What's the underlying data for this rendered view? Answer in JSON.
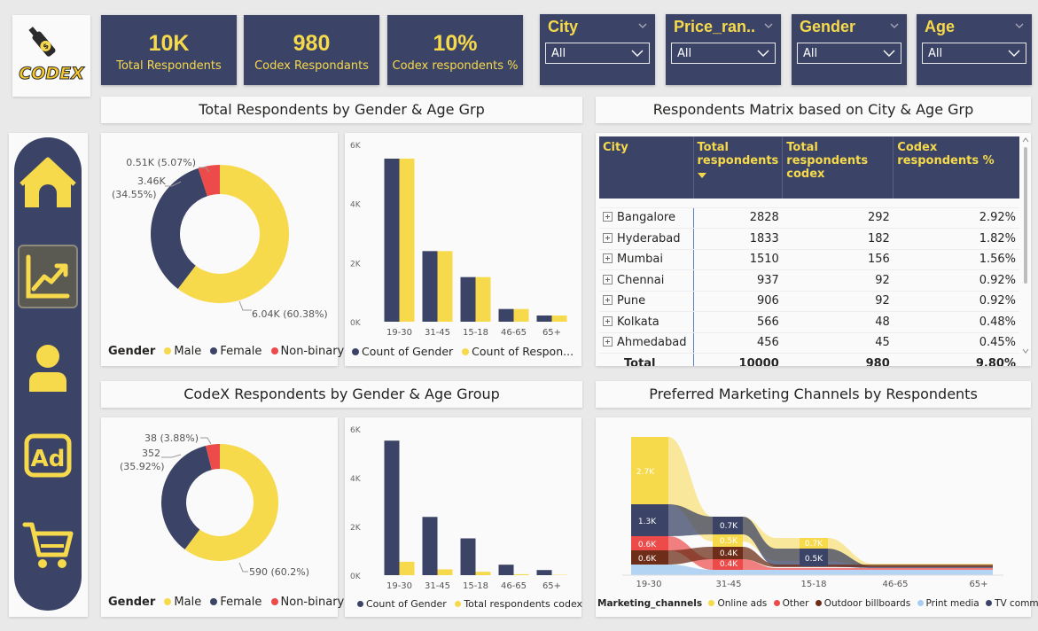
{
  "logo": {
    "text": "CODEX",
    "icon": "bottle-icon"
  },
  "kpis": [
    {
      "value": "10K",
      "label": "Total Respondents"
    },
    {
      "value": "980",
      "label": "Codex Respondants"
    },
    {
      "value": "10%",
      "label": "Codex respondents %"
    }
  ],
  "slicers": [
    {
      "title": "City",
      "value": "All"
    },
    {
      "title": "Price_ran...",
      "value": "All"
    },
    {
      "title": "Gender",
      "value": "All"
    },
    {
      "title": "Age",
      "value": "All"
    }
  ],
  "nav": [
    {
      "icon": "home-icon"
    },
    {
      "icon": "trend-chart-icon",
      "active": true
    },
    {
      "icon": "person-icon"
    },
    {
      "icon": "ad-icon"
    },
    {
      "icon": "cart-icon"
    }
  ],
  "colors": {
    "navy": "#3b4466",
    "yellow": "#f7d94c",
    "red": "#ed4a4a",
    "brown": "#6d2d18",
    "lightblue": "#a7cdf2",
    "orange_brown": "#8a3a1c"
  },
  "sections": {
    "total_by_gender_age": "Total Respondents by Gender & Age Grp",
    "matrix": "Respondents Matrix based on City & Age Grp",
    "codex_by_gender_age": "CodeX Respondents by Gender & Age Group",
    "marketing": "Preferred Marketing Channels by Respondents"
  },
  "donut_top": {
    "labels": {
      "nonbinary": "0.51K (5.07%)",
      "female_a": "3.46K",
      "female_b": "(34.55%)",
      "male": "6.04K (60.38%)"
    },
    "legend": {
      "title": "Gender",
      "items": [
        "Male",
        "Female",
        "Non-binary"
      ]
    }
  },
  "donut_bottom": {
    "labels": {
      "nonbinary": "38 (3.88%)",
      "female_a": "352",
      "female_b": "(35.92%)",
      "male": "590 (60.2%)"
    },
    "legend": {
      "title": "Gender",
      "items": [
        "Male",
        "Female",
        "Non-binary"
      ]
    }
  },
  "bar_top": {
    "yticks": [
      "6K",
      "4K",
      "2K",
      "0K"
    ],
    "legend": [
      "Count of Gender",
      "Count of Respon..."
    ]
  },
  "bar_bottom": {
    "yticks": [
      "6K",
      "4K",
      "2K",
      "0K"
    ],
    "legend": [
      "Count of Gender",
      "Total respondents codex"
    ]
  },
  "matrix": {
    "headers": [
      "City",
      "Total respondents",
      "Total respondents codex",
      "Codex respondents %"
    ],
    "rows": [
      [
        "Bangalore",
        "2828",
        "292",
        "2.92%"
      ],
      [
        "Hyderabad",
        "1833",
        "182",
        "1.82%"
      ],
      [
        "Mumbai",
        "1510",
        "156",
        "1.56%"
      ],
      [
        "Chennai",
        "937",
        "92",
        "0.92%"
      ],
      [
        "Pune",
        "906",
        "92",
        "0.92%"
      ],
      [
        "Kolkata",
        "566",
        "48",
        "0.48%"
      ],
      [
        "Ahmedabad",
        "456",
        "45",
        "0.45%"
      ]
    ],
    "total": [
      "Total",
      "10000",
      "980",
      "9.80%"
    ]
  },
  "marketing": {
    "xticks": [
      "19-30",
      "31-45",
      "15-18",
      "46-65",
      "65+"
    ],
    "labels": {
      "online_1930": "2.7K",
      "tv_1930": "1.3K",
      "other_1930": "0.6K",
      "outdoor_1930": "0.6K",
      "tv_3145": "0.7K",
      "online_3145": "0.5K",
      "outdoor_3145": "0.4K",
      "other_3145": "0.4K",
      "online_1518": "0.7K",
      "tv_1518": "0.5K"
    },
    "legend": {
      "title": "Marketing_channels",
      "items": [
        "Online ads",
        "Other",
        "Outdoor billboards",
        "Print media",
        "TV commerc..."
      ]
    }
  },
  "chart_data": [
    {
      "type": "pie",
      "title": "Total Respondents by Gender & Age Grp",
      "categories": [
        "Male",
        "Female",
        "Non-binary"
      ],
      "values": [
        6038,
        3455,
        507
      ],
      "legend": "bottom"
    },
    {
      "type": "bar",
      "title": "Total Respondents by Gender & Age Grp",
      "categories": [
        "19-30",
        "31-45",
        "15-18",
        "46-65",
        "65+"
      ],
      "series": [
        {
          "name": "Count of Gender",
          "values": [
            5520,
            2390,
            1510,
            430,
            210
          ]
        },
        {
          "name": "Count of Respon...",
          "values": [
            5520,
            2390,
            1510,
            430,
            210
          ]
        }
      ],
      "ylim": [
        0,
        6000
      ]
    },
    {
      "type": "pie",
      "title": "CodeX Respondents by Gender & Age Group",
      "categories": [
        "Male",
        "Female",
        "Non-binary"
      ],
      "values": [
        590,
        352,
        38
      ],
      "legend": "bottom"
    },
    {
      "type": "bar",
      "title": "CodeX Respondents by Gender & Age Group",
      "categories": [
        "19-30",
        "31-45",
        "15-18",
        "46-65",
        "65+"
      ],
      "series": [
        {
          "name": "Count of Gender",
          "values": [
            5520,
            2390,
            1510,
            430,
            210
          ]
        },
        {
          "name": "Total respondents codex",
          "values": [
            550,
            240,
            140,
            40,
            15
          ]
        }
      ],
      "ylim": [
        0,
        6000
      ]
    },
    {
      "type": "area",
      "title": "Preferred Marketing Channels by Respondents",
      "categories": [
        "19-30",
        "31-45",
        "15-18",
        "46-65",
        "65+"
      ],
      "series": [
        {
          "name": "Online ads",
          "values": [
            2700,
            500,
            700,
            120,
            40
          ]
        },
        {
          "name": "Other",
          "values": [
            600,
            400,
            120,
            40,
            20
          ]
        },
        {
          "name": "Outdoor billboards",
          "values": [
            600,
            400,
            150,
            50,
            20
          ]
        },
        {
          "name": "Print media",
          "values": [
            300,
            300,
            150,
            60,
            30
          ]
        },
        {
          "name": "TV commerc...",
          "values": [
            1300,
            700,
            500,
            150,
            60
          ]
        }
      ]
    }
  ]
}
